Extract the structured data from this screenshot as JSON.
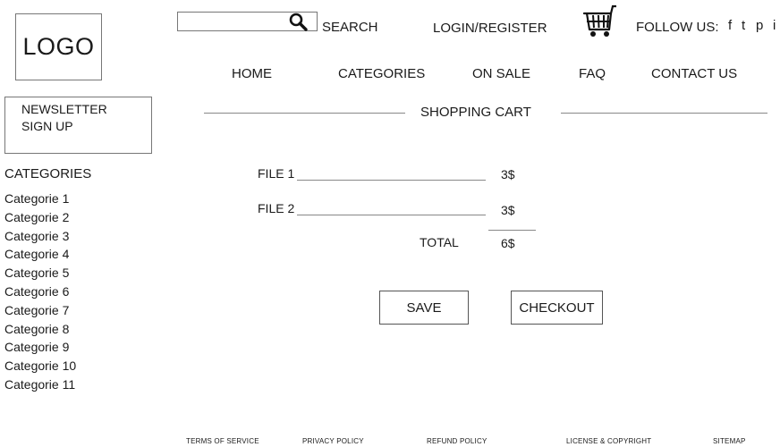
{
  "header": {
    "logo": "LOGO",
    "search": {
      "value": "",
      "placeholder": "",
      "button_label": "SEARCH"
    },
    "login_label": "LOGIN/REGISTER",
    "follow_label": "FOLLOW US:",
    "social": [
      "f",
      "t",
      "p",
      "i"
    ]
  },
  "nav": [
    "HOME",
    "CATEGORIES",
    "ON SALE",
    "FAQ",
    "CONTACT US"
  ],
  "sidebar": {
    "newsletter_line1": "NEWSLETTER",
    "newsletter_line2": "SIGN UP",
    "categories_heading": "CATEGORIES",
    "categories": [
      "Categorie 1",
      "Categorie 2",
      "Categorie 3",
      "Categorie 4",
      "Categorie 5",
      "Categorie  6",
      "Categorie  7",
      "Categorie  8",
      "Categorie  9",
      "Categorie 10",
      "Categorie 11"
    ]
  },
  "cart": {
    "title": "SHOPPING CART",
    "items": [
      {
        "name": "FILE 1",
        "price": "3$"
      },
      {
        "name": "FILE 2",
        "price": "3$"
      }
    ],
    "total_label": "TOTAL",
    "total_value": "6$",
    "save_label": "SAVE",
    "checkout_label": "CHECKOUT"
  },
  "footer": {
    "links": [
      "TERMS OF SERVICE",
      "PRIVACY POLICY",
      "REFUND POLICY",
      "LICENSE & COPYRIGHT",
      "SITEMAP"
    ]
  }
}
